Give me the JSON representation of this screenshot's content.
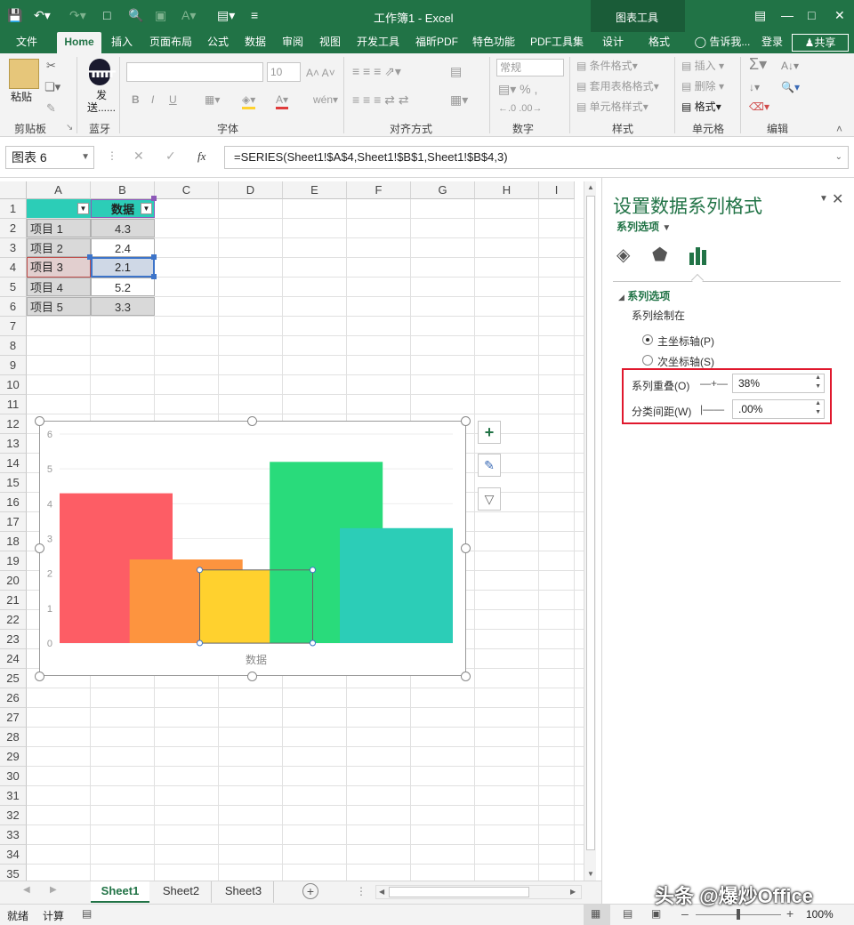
{
  "title_bar": {
    "document_title": "工作簿1 - Excel",
    "context_group": "图表工具"
  },
  "ribbon_tabs": [
    "文件",
    "Home",
    "插入",
    "页面布局",
    "公式",
    "数据",
    "审阅",
    "视图",
    "开发工具",
    "福昕PDF",
    "特色功能",
    "PDF工具集",
    "设计",
    "格式"
  ],
  "tell_me": "告诉我...",
  "account": {
    "login": "登录",
    "share": "共享"
  },
  "ribbon": {
    "clipboard": {
      "paste": "粘贴",
      "label": "剪贴板"
    },
    "bluetooth": {
      "send": "发送......",
      "label": "蓝牙"
    },
    "font": {
      "size": "10",
      "label": "字体",
      "bold": "B",
      "italic": "I",
      "underline": "U"
    },
    "align": {
      "label": "对齐方式"
    },
    "number": {
      "format": "常规",
      "label": "数字"
    },
    "styles": {
      "cond": "条件格式",
      "table": "套用表格格式",
      "cell": "单元格样式",
      "label": "样式"
    },
    "cells": {
      "insert": "插入",
      "delete": "删除",
      "format": "格式",
      "label": "单元格"
    },
    "editing": {
      "label": "编辑"
    }
  },
  "formula_bar": {
    "name_box": "图表 6",
    "fx": "fx",
    "formula": "=SERIES(Sheet1!$A$4,Sheet1!$B$1,Sheet1!$B$4,3)"
  },
  "columns": [
    "A",
    "B",
    "C",
    "D",
    "E",
    "F",
    "G",
    "H",
    "I"
  ],
  "rows": [
    "1",
    "2",
    "3",
    "4",
    "5",
    "6",
    "7",
    "8",
    "9",
    "10",
    "11",
    "12",
    "13",
    "14",
    "15",
    "16",
    "17",
    "18",
    "19",
    "20",
    "21",
    "22",
    "23",
    "24",
    "25",
    "26",
    "27",
    "28",
    "29",
    "30",
    "31",
    "32",
    "33",
    "34",
    "35"
  ],
  "table": {
    "header_b": "数据",
    "items": [
      "项目 1",
      "项目 2",
      "项目 3",
      "项目 4",
      "项目 5"
    ],
    "values": [
      "4.3",
      "2.4",
      "2.1",
      "5.2",
      "3.3"
    ]
  },
  "chart_data": {
    "type": "bar",
    "series": [
      {
        "name": "项目 1",
        "value": 4.3,
        "color": "#fd5d65"
      },
      {
        "name": "项目 2",
        "value": 2.4,
        "color": "#fd943f"
      },
      {
        "name": "项目 3",
        "value": 2.1,
        "color": "#ffd12e"
      },
      {
        "name": "项目 4",
        "value": 5.2,
        "color": "#29db7b"
      },
      {
        "name": "项目 5",
        "value": 3.3,
        "color": "#2ccdb7"
      }
    ],
    "xlabel": "数据",
    "ylim": [
      0,
      6
    ],
    "yticks": [
      "0",
      "1",
      "2",
      "3",
      "4",
      "5",
      "6"
    ],
    "series_overlap_pct": 38,
    "gap_width_pct": 0
  },
  "sheet_tabs": [
    "Sheet1",
    "Sheet2",
    "Sheet3"
  ],
  "status": {
    "ready": "就绪",
    "calc": "计算",
    "zoom": "100%"
  },
  "pane": {
    "title": "设置数据系列格式",
    "subtitle": "系列选项",
    "section": "系列选项",
    "plot_on": "系列绘制在",
    "primary_axis": "主坐标轴(P)",
    "secondary_axis": "次坐标轴(S)",
    "overlap_label": "系列重叠(O)",
    "overlap_value": "38%",
    "gap_label": "分类间距(W)",
    "gap_value": ".00%"
  },
  "watermark": "头条 @爆炒Office"
}
